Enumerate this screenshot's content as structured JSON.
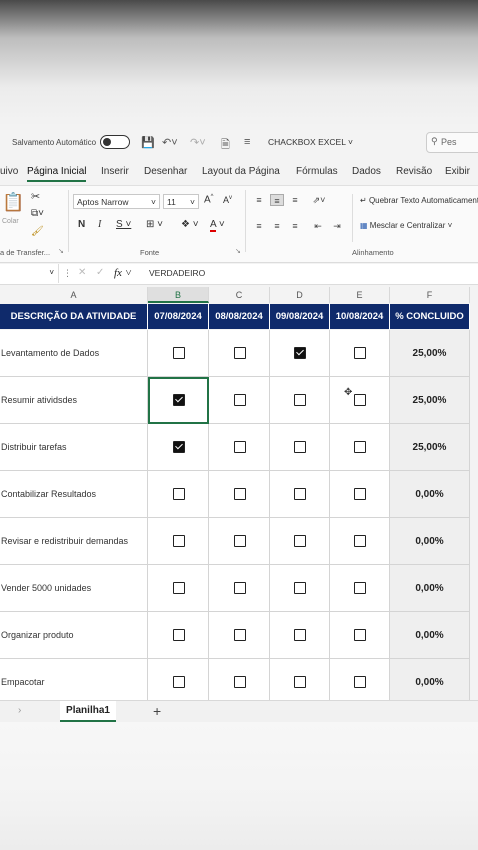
{
  "titlebar": {
    "autosave_label": "Salvamento Automático",
    "doc_title": "CHACKBOX EXCEL",
    "search_placeholder": "Pes"
  },
  "tabs": [
    {
      "label": "uivo"
    },
    {
      "label": "Página Inicial",
      "active": true
    },
    {
      "label": "Inserir"
    },
    {
      "label": "Desenhar"
    },
    {
      "label": "Layout da Página"
    },
    {
      "label": "Fórmulas"
    },
    {
      "label": "Dados"
    },
    {
      "label": "Revisão"
    },
    {
      "label": "Exibir"
    }
  ],
  "ribbon": {
    "paste_label": "Colar",
    "font_name": "Aptos Narrow",
    "font_size": "11",
    "wrap_text": "Quebrar Texto Automaticamente",
    "merge_center": "Mesclar e Centralizar",
    "groups": {
      "clipboard": "a de Transfer...",
      "font": "Fonte",
      "alignment": "Alinhamento"
    }
  },
  "formula_bar": {
    "fx": "fx",
    "value": "VERDADEIRO"
  },
  "columns": [
    "A",
    "B",
    "C",
    "D",
    "E",
    "F"
  ],
  "table": {
    "headers": [
      "DESCRIÇÃO DA ATIVIDADE",
      "07/08/2024",
      "08/08/2024",
      "09/08/2024",
      "10/08/2024",
      "% CONCLUIDO"
    ],
    "rows": [
      {
        "desc": "Levantamento de Dados",
        "checks": [
          false,
          false,
          true,
          false
        ],
        "pct": "25,00%"
      },
      {
        "desc": "Resumir atividsdes",
        "checks": [
          true,
          false,
          false,
          false
        ],
        "pct": "25,00%"
      },
      {
        "desc": "Distribuir tarefas",
        "checks": [
          true,
          false,
          false,
          false
        ],
        "pct": "25,00%"
      },
      {
        "desc": "Contabilizar Resultados",
        "checks": [
          false,
          false,
          false,
          false
        ],
        "pct": "0,00%"
      },
      {
        "desc": "Revisar e redistribuir demandas",
        "checks": [
          false,
          false,
          false,
          false
        ],
        "pct": "0,00%"
      },
      {
        "desc": "Vender 5000 unidades",
        "checks": [
          false,
          false,
          false,
          false
        ],
        "pct": "0,00%"
      },
      {
        "desc": "Organizar produto",
        "checks": [
          false,
          false,
          false,
          false
        ],
        "pct": "0,00%"
      },
      {
        "desc": "Empacotar",
        "checks": [
          false,
          false,
          false,
          false
        ],
        "pct": "0,00%"
      }
    ]
  },
  "sheets": {
    "active": "Planilha1",
    "add": "+"
  },
  "colors": {
    "header_bg": "#0f2a6b",
    "accent": "#217346"
  }
}
